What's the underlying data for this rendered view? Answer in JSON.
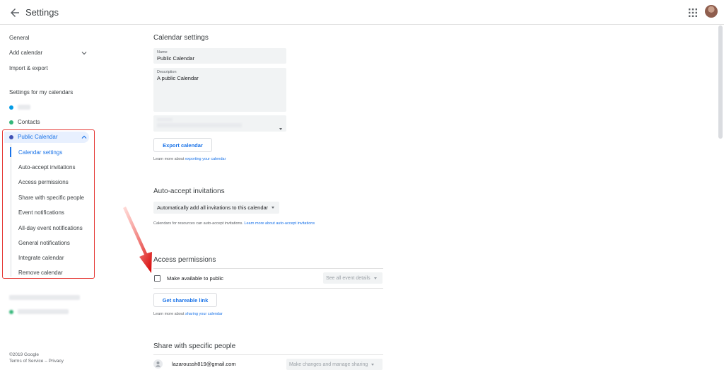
{
  "header": {
    "title": "Settings"
  },
  "sidebar": {
    "general": "General",
    "add_calendar": "Add calendar",
    "import_export": "Import & export",
    "section_my_calendars": "Settings for my calendars",
    "contacts": "Contacts",
    "public_calendar": "Public Calendar",
    "sub_items": [
      "Calendar settings",
      "Auto-accept invitations",
      "Access permissions",
      "Share with specific people",
      "Event notifications",
      "All-day event notifications",
      "General notifications",
      "Integrate calendar",
      "Remove calendar"
    ],
    "footer_copyright": "©2019 Google",
    "footer_links": "Terms of Service – Privacy"
  },
  "calendar_settings": {
    "heading": "Calendar settings",
    "name_label": "Name",
    "name_value": "Public Calendar",
    "description_label": "Description",
    "description_value": "A public Calendar",
    "export_button": "Export calendar",
    "learn_more_prefix": "Learn more about ",
    "learn_more_link": "exporting your calendar"
  },
  "auto_accept": {
    "heading": "Auto-accept invitations",
    "select_value": "Automatically add all invitations to this calendar",
    "note_prefix": "Calendars for resources can auto-accept invitations. ",
    "note_link": "Learn more about auto-accept invitations"
  },
  "access_permissions": {
    "heading": "Access permissions",
    "public_label": "Make available to public",
    "visibility_select": "See all event details",
    "share_button": "Get shareable link",
    "learn_more_prefix": "Learn more about ",
    "learn_more_link": "sharing your calendar"
  },
  "share_people": {
    "heading": "Share with specific people",
    "email": "lazaroussh819@gmail.com",
    "permission": "Make changes and manage sharing"
  },
  "colors": {
    "accent": "#1a73e8",
    "highlight": "#e8f0fe",
    "annotation": "#e53935",
    "contacts_dot": "#33b679",
    "public_dot": "#3f51b5",
    "blurred_dot": "#039be5"
  }
}
